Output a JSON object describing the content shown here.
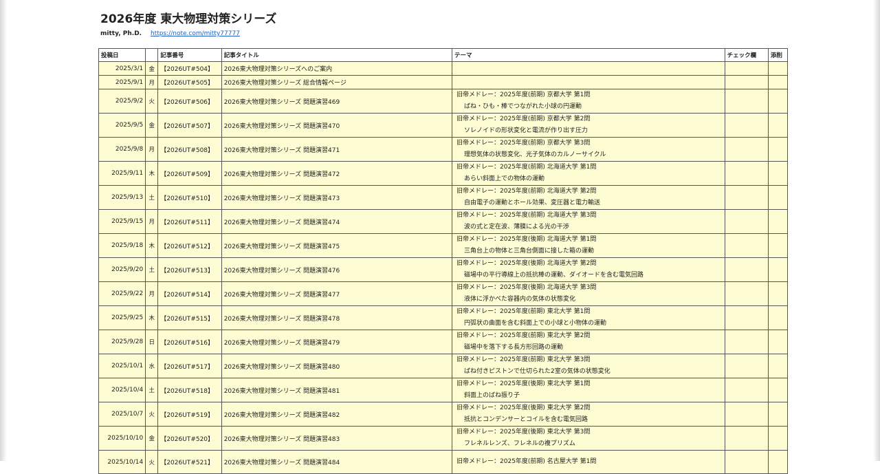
{
  "doc": {
    "title": "2026年度 東大物理対策シリーズ",
    "author": "mitty, Ph.D.",
    "link": "https://note.com/mitty77777"
  },
  "table": {
    "headers": {
      "date": "投稿日",
      "dow": "",
      "number": "記事番号",
      "title": "記事タイトル",
      "theme": "テーマ",
      "check": "チェック欄",
      "correction": "添削"
    },
    "rows": [
      {
        "date": "2025/3/1",
        "dow": "金",
        "number": "【2026UT#504】",
        "title": "2026東大物理対策シリーズへのご案内",
        "theme1": "",
        "theme2": ""
      },
      {
        "date": "2025/9/1",
        "dow": "月",
        "number": "【2026UT#505】",
        "title": "2026東大物理対策シリーズ 総合情報ページ",
        "theme1": "",
        "theme2": ""
      },
      {
        "date": "2025/9/2",
        "dow": "火",
        "number": "【2026UT#506】",
        "title": "2026東大物理対策シリーズ 問題演習469",
        "theme1": "旧帝メドレー：2025年度(前期) 京都大学 第1問",
        "theme2": "ばね・ひも・棒でつながれた小球の円運動"
      },
      {
        "date": "2025/9/5",
        "dow": "金",
        "number": "【2026UT#507】",
        "title": "2026東大物理対策シリーズ 問題演習470",
        "theme1": "旧帝メドレー：2025年度(前期) 京都大学 第2問",
        "theme2": "ソレノイドの形状変化と電流が作り出す圧力"
      },
      {
        "date": "2025/9/8",
        "dow": "月",
        "number": "【2026UT#508】",
        "title": "2026東大物理対策シリーズ 問題演習471",
        "theme1": "旧帝メドレー：2025年度(前期) 京都大学 第3問",
        "theme2": "理想気体の状態変化、光子気体のカルノーサイクル"
      },
      {
        "date": "2025/9/11",
        "dow": "木",
        "number": "【2026UT#509】",
        "title": "2026東大物理対策シリーズ 問題演習472",
        "theme1": "旧帝メドレー：2025年度(前期) 北海道大学 第1問",
        "theme2": "あらい斜面上での物体の運動"
      },
      {
        "date": "2025/9/13",
        "dow": "土",
        "number": "【2026UT#510】",
        "title": "2026東大物理対策シリーズ 問題演習473",
        "theme1": "旧帝メドレー：2025年度(前期) 北海道大学 第2問",
        "theme2": "自由電子の運動とホール効果、変圧器と電力輸送"
      },
      {
        "date": "2025/9/15",
        "dow": "月",
        "number": "【2026UT#511】",
        "title": "2026東大物理対策シリーズ 問題演習474",
        "theme1": "旧帝メドレー：2025年度(前期) 北海道大学 第3問",
        "theme2": "波の式と定在波、薄膜による光の干渉"
      },
      {
        "date": "2025/9/18",
        "dow": "木",
        "number": "【2026UT#512】",
        "title": "2026東大物理対策シリーズ 問題演習475",
        "theme1": "旧帝メドレー：2025年度(後期) 北海道大学 第1問",
        "theme2": "三角台上の物体と三角台側面に接した箱の運動"
      },
      {
        "date": "2025/9/20",
        "dow": "土",
        "number": "【2026UT#513】",
        "title": "2026東大物理対策シリーズ 問題演習476",
        "theme1": "旧帝メドレー：2025年度(後期) 北海道大学 第2問",
        "theme2": "磁場中の平行導線上の抵抗棒の運動、ダイオードを含む電気回路"
      },
      {
        "date": "2025/9/22",
        "dow": "月",
        "number": "【2026UT#514】",
        "title": "2026東大物理対策シリーズ 問題演習477",
        "theme1": "旧帝メドレー：2025年度(後期) 北海道大学 第3問",
        "theme2": "液体に浮かべた容器内の気体の状態変化"
      },
      {
        "date": "2025/9/25",
        "dow": "木",
        "number": "【2026UT#515】",
        "title": "2026東大物理対策シリーズ 問題演習478",
        "theme1": "旧帝メドレー：2025年度(前期) 東北大学 第1問",
        "theme2": "円弧状の曲面を含む斜面上での小球と小物体の運動"
      },
      {
        "date": "2025/9/28",
        "dow": "日",
        "number": "【2026UT#516】",
        "title": "2026東大物理対策シリーズ 問題演習479",
        "theme1": "旧帝メドレー：2025年度(前期) 東北大学 第2問",
        "theme2": "磁場中を落下する長方形回路の運動"
      },
      {
        "date": "2025/10/1",
        "dow": "水",
        "number": "【2026UT#517】",
        "title": "2026東大物理対策シリーズ 問題演習480",
        "theme1": "旧帝メドレー：2025年度(前期) 東北大学 第3問",
        "theme2": "ばね付きピストンで仕切られた2室の気体の状態変化"
      },
      {
        "date": "2025/10/4",
        "dow": "土",
        "number": "【2026UT#518】",
        "title": "2026東大物理対策シリーズ 問題演習481",
        "theme1": "旧帝メドレー：2025年度(後期) 東北大学 第1問",
        "theme2": "斜面上のばね振り子"
      },
      {
        "date": "2025/10/7",
        "dow": "火",
        "number": "【2026UT#519】",
        "title": "2026東大物理対策シリーズ 問題演習482",
        "theme1": "旧帝メドレー：2025年度(後期) 東北大学 第2問",
        "theme2": "抵抗とコンデンサーとコイルを含む電気回路"
      },
      {
        "date": "2025/10/10",
        "dow": "金",
        "number": "【2026UT#520】",
        "title": "2026東大物理対策シリーズ 問題演習483",
        "theme1": "旧帝メドレー：2025年度(後期) 東北大学 第3問",
        "theme2": "フレネルレンズ、フレネルの複プリズム"
      },
      {
        "date": "2025/10/14",
        "dow": "火",
        "number": "【2026UT#521】",
        "title": "2026東大物理対策シリーズ 問題演習484",
        "theme1": "旧帝メドレー：2025年度(前期) 名古屋大学 第1問",
        "theme2": ""
      }
    ]
  }
}
